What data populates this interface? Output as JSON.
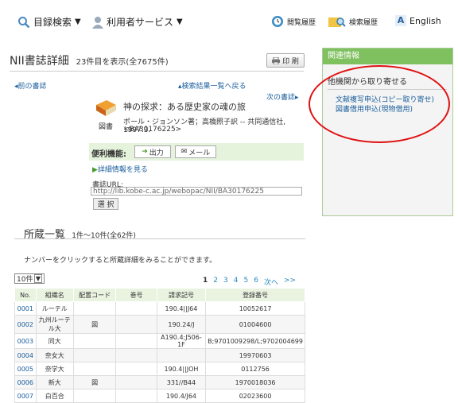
{
  "nav": {
    "catalog": "目録検索",
    "user_service": "利用者サービス",
    "history": "閲覧履歴",
    "search_history": "検索履歴",
    "english": "English"
  },
  "page": {
    "title": "NII書誌詳細",
    "count": "23件目を表示(全7675件)",
    "print": "印 刷",
    "prev": "前の書誌",
    "back": "検索結果一覧へ戻る",
    "next": "次の書誌"
  },
  "book": {
    "title": "神の探求：ある歴史家の魂の旅",
    "author": "ポール・ジョンソン著；高橋照子訳 -- 共同通信社, 1997.3.",
    "id": "<BA30176225>",
    "type": "図書"
  },
  "util": {
    "label": "便利機能:",
    "output": "出力",
    "mail": "メール",
    "detail": "詳細情報を見る",
    "url_label": "書誌URL:",
    "url": "http://lib.kobe-c.ac.jp/webopac/NII/BA30176225",
    "select": "選 択"
  },
  "sidebar": {
    "head": "関連情報",
    "sub": "他機関から取り寄せる",
    "link1": "文献複写申込(コピー取り寄せ)",
    "link2": "図書借用申込(現物借用)"
  },
  "holdings": {
    "title": "所蔵一覧",
    "range": "1件～10件(全62件)",
    "hint": "ナンバーをクリックすると所蔵詳細をみることができます。",
    "perpage": "10件",
    "pages": [
      "1",
      "2",
      "3",
      "4",
      "5",
      "6",
      "次へ",
      ">>"
    ],
    "headers": [
      "No.",
      "組織名",
      "配置コード",
      "巻号",
      "請求記号",
      "登録番号"
    ],
    "rows": [
      [
        "0001",
        "ルーテル",
        "",
        "",
        "190.4||J64",
        "10052617"
      ],
      [
        "0002",
        "九州ルーテル大",
        "図",
        "",
        "190.24/J",
        "01004600"
      ],
      [
        "0003",
        "同大",
        "",
        "",
        "A190.4;J506-1F",
        "B;9701009298/L;9702004699"
      ],
      [
        "0004",
        "奈女大",
        "",
        "",
        "",
        "19970603"
      ],
      [
        "0005",
        "奈学大",
        "",
        "",
        "190.4||JOH",
        "0112756"
      ],
      [
        "0006",
        "新大",
        "図",
        "",
        "331//B44",
        "1970018036"
      ],
      [
        "0007",
        "白百合",
        "",
        "",
        "190.4/J64",
        "02023600"
      ]
    ]
  },
  "colors": {
    "accent": "#7fc05f",
    "link": "#1a5e9c",
    "annotation": "#e01010"
  }
}
